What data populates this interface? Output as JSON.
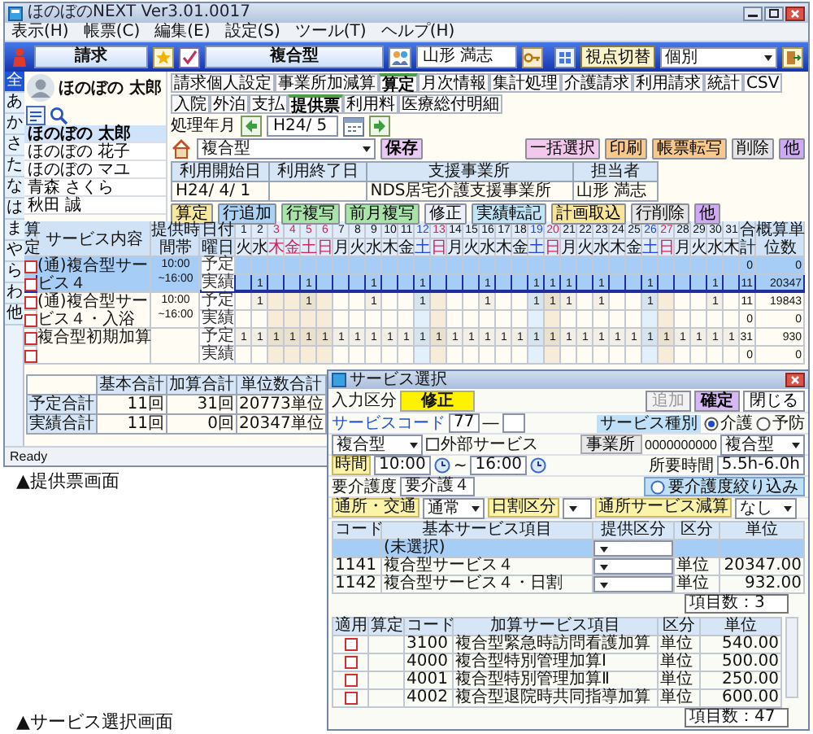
{
  "main_window": {
    "title": "ほのぼのNEXT Ver3.01.0017",
    "menu": [
      "表示(H)",
      "帳票(C)",
      "編集(E)",
      "設定(S)",
      "ツール(T)",
      "ヘルプ(H)"
    ],
    "toolbar": {
      "module": "請求",
      "service_type": "複合型",
      "staff": "山形 満志",
      "view_button": "視点切替",
      "view_select": "個別"
    },
    "user": {
      "name": "ほのぼの 太郎"
    },
    "kana_tabs": [
      {
        "label": "全",
        "selected": true
      },
      {
        "label": "あ",
        "selected": false
      },
      {
        "label": "か",
        "selected": false
      },
      {
        "label": "さ",
        "selected": false
      },
      {
        "label": "た",
        "selected": false
      },
      {
        "label": "な",
        "selected": false
      },
      {
        "label": "は",
        "selected": false
      },
      {
        "label": "ま",
        "selected": false
      },
      {
        "label": "や",
        "selected": false
      },
      {
        "label": "ら",
        "selected": false
      },
      {
        "label": "わ",
        "selected": false
      },
      {
        "label": "他",
        "selected": false
      }
    ],
    "user_list": [
      {
        "name": "ほのぼの 太郎",
        "selected": true
      },
      {
        "name": "ほのぼの 花子",
        "selected": false
      },
      {
        "name": "ほのぼの マユ",
        "selected": false
      },
      {
        "name": "青森 さくら",
        "selected": false
      },
      {
        "name": "秋田 誠",
        "selected": false
      }
    ],
    "tabs_row_1": [
      {
        "label": "請求個人設定",
        "selected": false
      },
      {
        "label": "事業所加減算",
        "selected": false
      },
      {
        "label": "算定",
        "selected": true
      },
      {
        "label": "月次情報",
        "selected": false
      },
      {
        "label": "集計処理",
        "selected": false
      },
      {
        "label": "介護請求",
        "selected": false
      },
      {
        "label": "利用請求",
        "selected": false
      },
      {
        "label": "統計",
        "selected": false
      },
      {
        "label": "CSV",
        "selected": false
      }
    ],
    "tabs_row_2": [
      {
        "label": "入院",
        "selected": false
      },
      {
        "label": "外泊",
        "selected": false
      },
      {
        "label": "支払",
        "selected": false
      },
      {
        "label": "提供票",
        "selected": true
      },
      {
        "label": "利用料",
        "selected": false
      },
      {
        "label": "医療総付明細",
        "selected": false
      }
    ],
    "period": {
      "label": "処理年月",
      "value": "H24/ 5"
    },
    "service_select": "複合型",
    "save_button": "保存",
    "actions": [
      {
        "label": "一括選択",
        "color": "#f4c8ec"
      },
      {
        "label": "印刷",
        "color": "#f8c98c"
      },
      {
        "label": "帳票転写",
        "color": "#f8c98c"
      },
      {
        "label": "削除",
        "color": "#e4e4e4"
      },
      {
        "label": "他",
        "color": "#cfa9f2"
      }
    ],
    "support_table": {
      "columns": [
        "利用開始日",
        "利用終了日",
        "支援事業所",
        "担当者"
      ],
      "rows": [
        {
          "start": "H24/ 4/ 1",
          "office": "NDS居宅介護支援事業所",
          "staff": "山形 満志"
        }
      ]
    },
    "row_actions": [
      {
        "label": "算定",
        "color": "#f7e8a0"
      },
      {
        "label": "行追加",
        "color": "#a9d2f5"
      },
      {
        "label": "行複写",
        "color": "#a8e4a8"
      },
      {
        "label": "前月複写",
        "color": "#a8e4a8"
      },
      {
        "label": "修正",
        "color": "#eef0fa"
      },
      {
        "label": "実績転記",
        "color": "#bfe5f7"
      },
      {
        "label": "計画取込",
        "color": "#f7e59a"
      },
      {
        "label": "行削除",
        "color": "#e4e4e4"
      },
      {
        "label": "他",
        "color": "#cfa9f2"
      }
    ],
    "grid": {
      "headers": {
        "check": "算定",
        "service": "サービス内容",
        "time": "提供時間帯",
        "date": "日付",
        "weekday": "曜日",
        "total": "合計",
        "units": "概算単位数"
      },
      "days": [
        {
          "day": "1",
          "weekday": "火",
          "kind": "weekday"
        },
        {
          "day": "2",
          "weekday": "水",
          "kind": "weekday"
        },
        {
          "day": "3",
          "weekday": "木",
          "kind": "holiday"
        },
        {
          "day": "4",
          "weekday": "金",
          "kind": "holiday"
        },
        {
          "day": "5",
          "weekday": "土",
          "kind": "holiday"
        },
        {
          "day": "6",
          "weekday": "日",
          "kind": "holiday"
        },
        {
          "day": "7",
          "weekday": "月",
          "kind": "weekday"
        },
        {
          "day": "8",
          "weekday": "火",
          "kind": "weekday"
        },
        {
          "day": "9",
          "weekday": "水",
          "kind": "weekday"
        },
        {
          "day": "10",
          "weekday": "木",
          "kind": "weekday"
        },
        {
          "day": "11",
          "weekday": "金",
          "kind": "weekday"
        },
        {
          "day": "12",
          "weekday": "土",
          "kind": "saturday"
        },
        {
          "day": "13",
          "weekday": "日",
          "kind": "holiday"
        },
        {
          "day": "14",
          "weekday": "月",
          "kind": "weekday"
        },
        {
          "day": "15",
          "weekday": "火",
          "kind": "weekday"
        },
        {
          "day": "16",
          "weekday": "水",
          "kind": "weekday"
        },
        {
          "day": "17",
          "weekday": "木",
          "kind": "weekday"
        },
        {
          "day": "18",
          "weekday": "金",
          "kind": "weekday"
        },
        {
          "day": "19",
          "weekday": "土",
          "kind": "saturday"
        },
        {
          "day": "20",
          "weekday": "日",
          "kind": "holiday"
        },
        {
          "day": "21",
          "weekday": "月",
          "kind": "weekday"
        },
        {
          "day": "22",
          "weekday": "火",
          "kind": "weekday"
        },
        {
          "day": "23",
          "weekday": "水",
          "kind": "weekday"
        },
        {
          "day": "24",
          "weekday": "木",
          "kind": "weekday"
        },
        {
          "day": "25",
          "weekday": "金",
          "kind": "weekday"
        },
        {
          "day": "26",
          "weekday": "土",
          "kind": "saturday"
        },
        {
          "day": "27",
          "weekday": "日",
          "kind": "holiday"
        },
        {
          "day": "28",
          "weekday": "月",
          "kind": "weekday"
        },
        {
          "day": "29",
          "weekday": "火",
          "kind": "weekday"
        },
        {
          "day": "30",
          "weekday": "水",
          "kind": "weekday"
        },
        {
          "day": "31",
          "weekday": "木",
          "kind": "weekday"
        }
      ],
      "rows": [
        {
          "service": "(通)複合型サービス４",
          "time_from": "10:00",
          "time_to": "~16:00",
          "selected": true,
          "lines": [
            {
              "label": "予定",
              "checked": false,
              "total": "0",
              "units": "0"
            },
            {
              "label": "実績",
              "checked": false,
              "cells": [
                {
                  "filled": false
                },
                {
                  "filled": true,
                  "value": "1"
                },
                {
                  "filled": false
                },
                {
                  "filled": false
                },
                {
                  "filled": true,
                  "value": "1"
                },
                {
                  "filled": false
                },
                {
                  "filled": false
                },
                {
                  "filled": false
                },
                {
                  "filled": true,
                  "value": "1"
                },
                {
                  "filled": false
                },
                {
                  "filled": false
                },
                {
                  "filled": true,
                  "value": "1"
                },
                {
                  "filled": false
                },
                {
                  "filled": false
                },
                {
                  "filled": false
                },
                {
                  "filled": true,
                  "value": "1"
                },
                {
                  "filled": false
                },
                {
                  "filled": false
                },
                {
                  "filled": true,
                  "value": "1"
                },
                {
                  "filled": true,
                  "value": "1"
                },
                {
                  "filled": true,
                  "value": "1"
                },
                {
                  "filled": false
                },
                {
                  "filled": true,
                  "value": "1"
                },
                {
                  "filled": false
                },
                {
                  "filled": false
                },
                {
                  "filled": true,
                  "value": "1"
                },
                {
                  "filled": false
                },
                {
                  "filled": false
                },
                {
                  "filled": false
                },
                {
                  "filled": true,
                  "value": "1"
                },
                {
                  "filled": false
                }
              ],
              "total": "11",
              "units": "20347"
            }
          ]
        },
        {
          "service": "(通)複合型サービス４・入浴",
          "time_from": "10:00",
          "time_to": "~16:00",
          "selected": false,
          "lines": [
            {
              "label": "予定",
              "checked": false,
              "cells": [
                {
                  "filled": false
                },
                {
                  "filled": true,
                  "value": "1"
                },
                {
                  "filled": false
                },
                {
                  "filled": false
                },
                {
                  "filled": true,
                  "value": "1"
                },
                {
                  "filled": false
                },
                {
                  "filled": false
                },
                {
                  "filled": false
                },
                {
                  "filled": true,
                  "value": "1"
                },
                {
                  "filled": false
                },
                {
                  "filled": false
                },
                {
                  "filled": true,
                  "value": "1"
                },
                {
                  "filled": false
                },
                {
                  "filled": false
                },
                {
                  "filled": false
                },
                {
                  "filled": true,
                  "value": "1"
                },
                {
                  "filled": false
                },
                {
                  "filled": false
                },
                {
                  "filled": true,
                  "value": "1"
                },
                {
                  "filled": true,
                  "value": "1"
                },
                {
                  "filled": true,
                  "value": "1"
                },
                {
                  "filled": false
                },
                {
                  "filled": true,
                  "value": "1"
                },
                {
                  "filled": false
                },
                {
                  "filled": false
                },
                {
                  "filled": true,
                  "value": "1"
                },
                {
                  "filled": false
                },
                {
                  "filled": false
                },
                {
                  "filled": false
                },
                {
                  "filled": true,
                  "value": "1"
                },
                {
                  "filled": false
                }
              ],
              "total": "11",
              "units": "19843"
            },
            {
              "label": "実績",
              "checked": false,
              "total": "0",
              "units": "0"
            }
          ]
        },
        {
          "service": "複合型初期加算",
          "selected": false,
          "lines": [
            {
              "label": "予定",
              "checked": false,
              "cells": [
                {
                  "filled": true,
                  "value": "1"
                },
                {
                  "filled": true,
                  "value": "1"
                },
                {
                  "filled": true,
                  "value": "1"
                },
                {
                  "filled": true,
                  "value": "1"
                },
                {
                  "filled": true,
                  "value": "1"
                },
                {
                  "filled": true,
                  "value": "1"
                },
                {
                  "filled": true,
                  "value": "1"
                },
                {
                  "filled": true,
                  "value": "1"
                },
                {
                  "filled": true,
                  "value": "1"
                },
                {
                  "filled": true,
                  "value": "1"
                },
                {
                  "filled": true,
                  "value": "1"
                },
                {
                  "filled": true,
                  "value": "1"
                },
                {
                  "filled": true,
                  "value": "1"
                },
                {
                  "filled": true,
                  "value": "1"
                },
                {
                  "filled": true,
                  "value": "1"
                },
                {
                  "filled": true,
                  "value": "1"
                },
                {
                  "filled": true,
                  "value": "1"
                },
                {
                  "filled": true,
                  "value": "1"
                },
                {
                  "filled": true,
                  "value": "1"
                },
                {
                  "filled": true,
                  "value": "1"
                },
                {
                  "filled": true,
                  "value": "1"
                },
                {
                  "filled": true,
                  "value": "1"
                },
                {
                  "filled": true,
                  "value": "1"
                },
                {
                  "filled": true,
                  "value": "1"
                },
                {
                  "filled": true,
                  "value": "1"
                },
                {
                  "filled": true,
                  "value": "1"
                },
                {
                  "filled": true,
                  "value": "1"
                },
                {
                  "filled": true,
                  "value": "1"
                },
                {
                  "filled": true,
                  "value": "1"
                },
                {
                  "filled": true,
                  "value": "1"
                },
                {
                  "filled": true,
                  "value": "1"
                }
              ],
              "total": "31",
              "units": "930"
            },
            {
              "label": "実績",
              "checked": false,
              "total": "0",
              "units": "0"
            }
          ]
        }
      ]
    },
    "totals": {
      "columns": [
        "基本合計",
        "加算合計",
        "単位数合計"
      ],
      "rows": [
        {
          "label": "予定合計",
          "values": [
            "11回",
            "31回",
            "20773単位"
          ]
        },
        {
          "label": "実績合計",
          "values": [
            "11回",
            "0回",
            "20347単位"
          ]
        }
      ]
    },
    "status_bar": "Ready"
  },
  "caption_1": "▲提供票画面",
  "service_dialog": {
    "title": "サービス選択",
    "input_label": "入力区分",
    "input_value": "修正",
    "buttons": [
      {
        "label": "追加",
        "disabled": true,
        "primary": false
      },
      {
        "label": "確定",
        "disabled": false,
        "primary": true
      },
      {
        "label": "閉じる",
        "disabled": false,
        "primary": false
      }
    ],
    "service_code": {
      "label": "サービスコード",
      "value": "77",
      "separator": "―"
    },
    "service_kind": {
      "label": "サービス種別",
      "options": [
        {
          "label": "介護",
          "selected": true
        },
        {
          "label": "予防",
          "selected": false
        }
      ],
      "select": "複合型"
    },
    "external": {
      "label": "外部サービス",
      "checked": false
    },
    "office": {
      "button": "事業所",
      "code": "0000000000",
      "name": "複合型"
    },
    "time": {
      "label": "時間",
      "from": "10:00",
      "separator": "~",
      "to": "16:00"
    },
    "duration": {
      "label": "所要時間",
      "value": "5.5h-6.0h"
    },
    "care_level": {
      "label": "要介護度",
      "value": "要介護４",
      "filter": "要介護度絞り込み"
    },
    "conditions": [
      {
        "label": "通所・交通",
        "value": "通常"
      },
      {
        "label": "日割区分"
      },
      {
        "label": "通所サービス減算",
        "value": "なし"
      }
    ],
    "basic_services": {
      "columns": [
        "コード",
        "基本サービス項目",
        "提供区分",
        "区分",
        "単位"
      ],
      "rows": [
        {
          "item": "(未選択)",
          "selected": true
        },
        {
          "code": "1141",
          "item": "複合型サービス４",
          "unit_type": "単位",
          "units": "20347.00",
          "selected": false
        },
        {
          "code": "1142",
          "item": "複合型サービス４・日割",
          "unit_type": "単位",
          "units": "932.00",
          "selected": false
        }
      ],
      "count": "項目数：3"
    },
    "additions": {
      "columns": [
        "適用",
        "算定",
        "コード",
        "加算サービス項目",
        "区分",
        "単位"
      ],
      "rows": [
        {
          "applied": false,
          "code": "3100",
          "item": "複合型緊急時訪問看護加算",
          "unit_type": "単位",
          "units": "540.00"
        },
        {
          "applied": false,
          "code": "4000",
          "item": "複合型特別管理加算Ⅰ",
          "unit_type": "単位",
          "units": "500.00"
        },
        {
          "applied": false,
          "code": "4001",
          "item": "複合型特別管理加算Ⅱ",
          "unit_type": "単位",
          "units": "250.00"
        },
        {
          "applied": false,
          "code": "4002",
          "item": "複合型退院時共同指導加算",
          "unit_type": "単位",
          "units": "600.00"
        }
      ],
      "count": "項目数：47"
    }
  },
  "caption_2": "▲サービス選択画面"
}
